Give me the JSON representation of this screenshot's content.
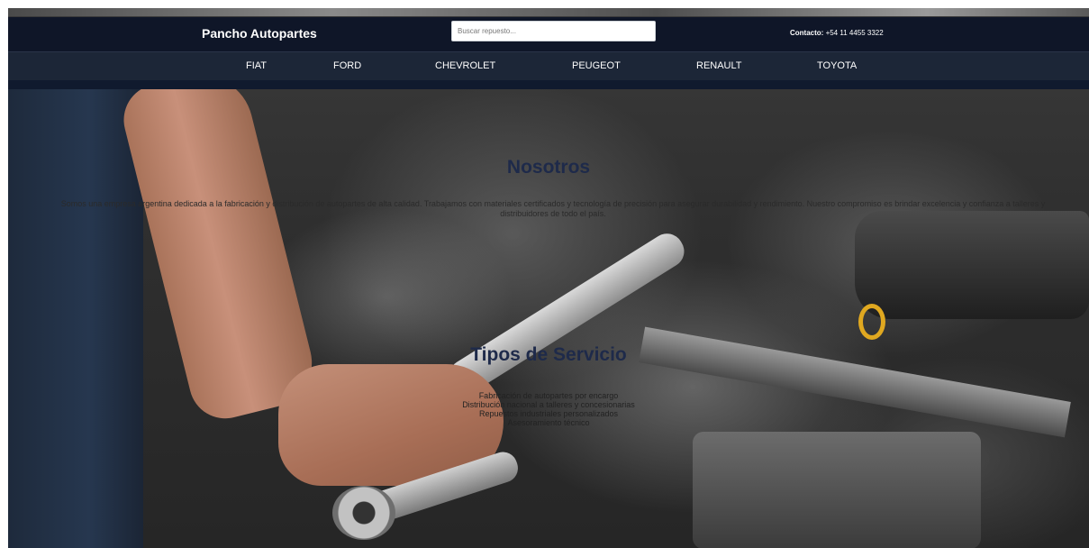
{
  "header": {
    "brand": "Pancho Autopartes",
    "search_placeholder": "Buscar repuesto...",
    "contact_label": "Contacto:",
    "contact_phone": "+54 11 4455 3322"
  },
  "nav": {
    "items": [
      "FIAT",
      "FORD",
      "CHEVROLET",
      "PEUGEOT",
      "RENAULT",
      "TOYOTA"
    ]
  },
  "about": {
    "title": "Nosotros",
    "text": "Somos una empresa argentina dedicada a la fabricación y distribución de autopartes de alta calidad. Trabajamos con materiales certificados y tecnología de precisión para asegurar durabilidad y rendimiento. Nuestro compromiso es brindar excelencia y confianza a talleres y distribuidores de todo el país."
  },
  "services": {
    "title": "Tipos de Servicio",
    "items": [
      "Fabricación de autopartes por encargo",
      "Distribución nacional a talleres y concesionarias",
      "Repuestos industriales personalizados",
      "Asesoramiento técnico"
    ]
  },
  "colors": {
    "topbar": "#0f1628",
    "navbar": "#1c2637",
    "title": "#1e2a4a"
  }
}
